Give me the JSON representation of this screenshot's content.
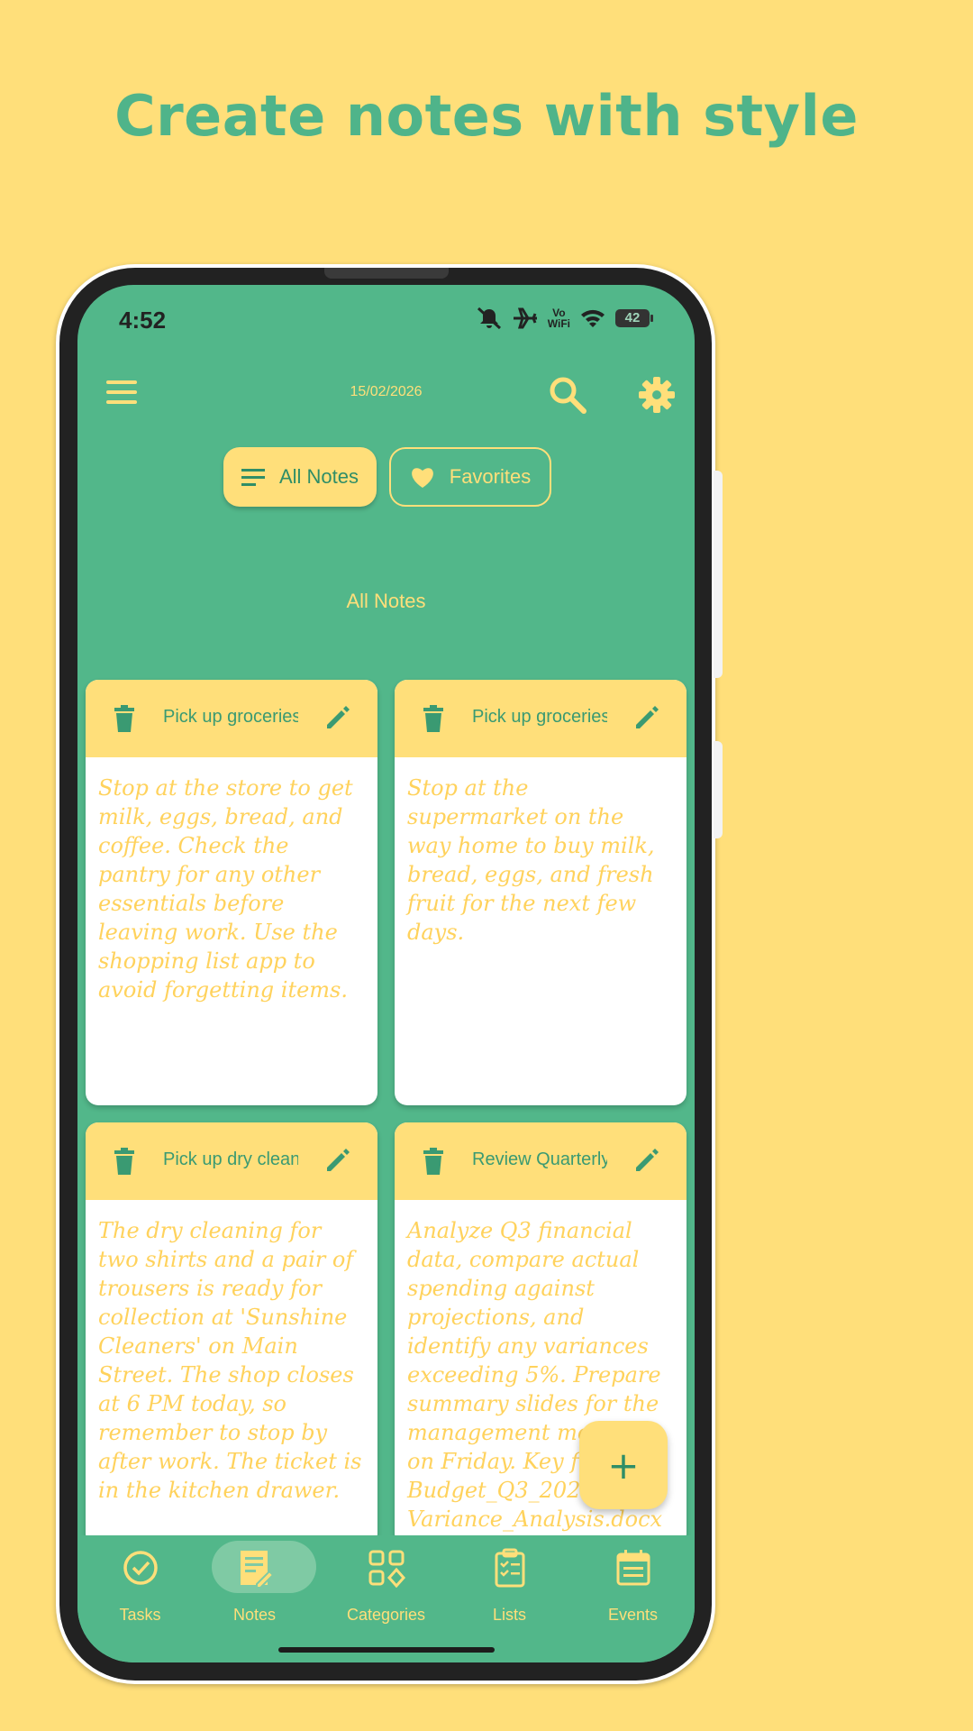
{
  "headline": "Create notes with style",
  "status_bar": {
    "time": "4:52",
    "network_label": "Vo\nWiFi",
    "battery": "42"
  },
  "app_bar": {
    "date": "15/02/2026"
  },
  "filters": {
    "all_label": "All Notes",
    "favorites_label": "Favorites"
  },
  "section_title": "All Notes",
  "notes": [
    {
      "title": "Pick up groceries on",
      "body": "Stop at the store to get milk, eggs, bread, and coffee. Check the pantry for any other essentials before leaving work. Use the shopping list app to avoid forgetting items."
    },
    {
      "title": "Pick up groceries ap",
      "body": "Stop at the supermarket on the way home to buy milk, bread, eggs, and fresh fruit for the next few days."
    },
    {
      "title": "Pick up dry cleaning",
      "body": "The dry cleaning for two shirts and a pair of trousers is ready for collection at 'Sunshine Cleaners' on Main Street. The shop closes at 6 PM today, so remember to stop by after work. The ticket is in the kitchen drawer."
    },
    {
      "title": "Review Quarterly B",
      "body": "Analyze Q3 financial data, compare actual spending against projections, and identify any variances exceeding 5%. Prepare summary slides for the management meeting on Friday. Key files: Budget_Q3_2023.xlsx, Variance_Analysis.docx in shared drive. This is a"
    }
  ],
  "fab": {
    "label": "+"
  },
  "nav": [
    {
      "label": "Tasks",
      "active": false
    },
    {
      "label": "Notes",
      "active": true
    },
    {
      "label": "Categories",
      "active": false
    },
    {
      "label": "Lists",
      "active": false
    },
    {
      "label": "Events",
      "active": false
    }
  ],
  "colors": {
    "background": "#FFDF7A",
    "primary": "#52B78A",
    "accent": "#FFDF7A",
    "text_green": "#4FB48A"
  }
}
